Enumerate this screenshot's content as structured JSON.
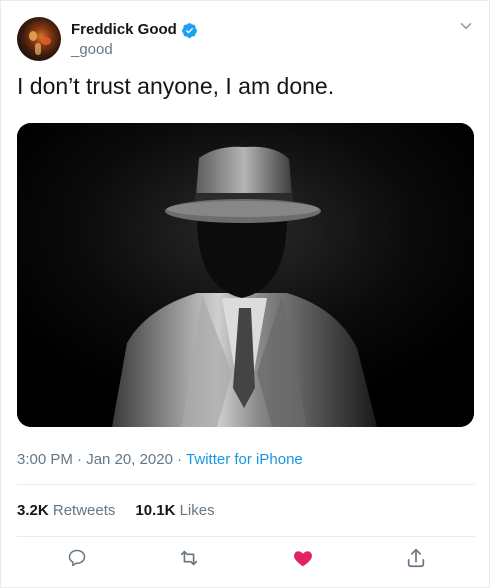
{
  "tweet": {
    "author": {
      "display_name": "Freddick Good",
      "handle": "_good",
      "verified": true,
      "avatar_icon": "avatar-photo"
    },
    "text": "I don’t trust anyone, I am done.",
    "media": {
      "icon": "photo-man-in-hat-and-trench-coat"
    },
    "meta": {
      "time": "3:00 PM",
      "separator": "·",
      "date": "Jan 20, 2020",
      "source": "Twitter for iPhone"
    },
    "stats": {
      "retweets_count": "3.2K",
      "retweets_label": "Retweets",
      "likes_count": "10.1K",
      "likes_label": "Likes"
    },
    "actions": [
      {
        "name": "reply",
        "icon": "reply-icon"
      },
      {
        "name": "retweet",
        "icon": "retweet-icon"
      },
      {
        "name": "like",
        "icon": "heart-icon",
        "active": true
      },
      {
        "name": "share",
        "icon": "share-icon"
      }
    ],
    "colors": {
      "text": "#14171a",
      "secondary": "#657786",
      "link": "#1b95e0",
      "verified": "#1da1f2",
      "like_active": "#e0245e",
      "border": "#e6ecf0"
    }
  }
}
